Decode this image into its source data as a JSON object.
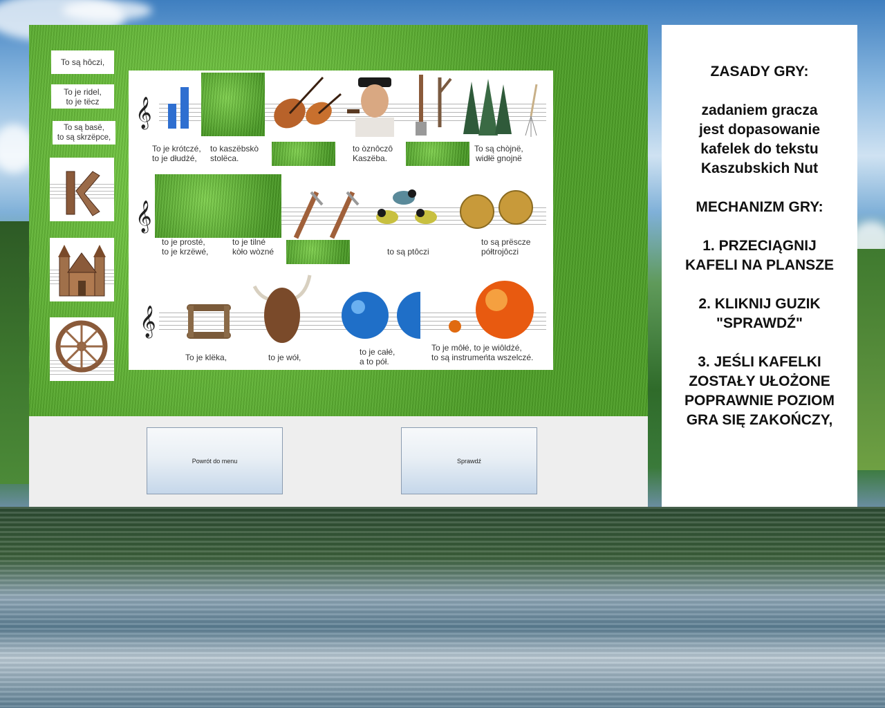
{
  "tiles": {
    "label1": "To są hôczi,",
    "label2": "To je ridel,\nto je tëcz",
    "label3": "To są basë,\nto są skrzëpce,",
    "icon_k": "letter-k-tile-icon",
    "icon_church": "church-tile-icon",
    "icon_wheel": "wheel-tile-icon"
  },
  "board": {
    "row1": {
      "t1": "To je krótczé,\nto je dłudżé,",
      "t2": "to kaszëbskò\nstolëca.",
      "t3": "to òznôczô\nKaszëba.",
      "t4": "To są chòjnë,\nwidłë gnojnë"
    },
    "row2": {
      "t1": "to je prosté,\nto je krzëwé,",
      "t2": "to je tilné\nkòło wòzné",
      "t3": "to są ptôczi",
      "t4": "to są prëscze\npółtrojôczi"
    },
    "row3": {
      "t1": "To je klëka,",
      "t2": "to je wół,",
      "t3": "to je całé,\na to pół.",
      "t4": "To je môłé, to je wiôldżé,\nto są instrumeńta wszelczé."
    }
  },
  "buttons": {
    "back": "Powrót do menu",
    "check": "Sprawdź"
  },
  "rules": {
    "title": "ZASADY GRY:",
    "goal1": "zadaniem gracza",
    "goal2": "jest dopasowanie",
    "goal3": "kafelek do tekstu",
    "goal4": "Kaszubskich Nut",
    "mech_title": "MECHANIZM GRY:",
    "s1a": "1. PRZECIĄGNIJ",
    "s1b": "KAFELI NA PLANSZE",
    "s2a": "2. KLIKNIJ GUZIK",
    "s2b": "\"SPRAWDŹ\"",
    "s3a": "3. JEŚLI KAFELKI",
    "s3b": "ZOSTAŁY UŁOŻONE",
    "s3c": "POPRAWNIE POZIOM",
    "s3d": "GRA SIĘ ZAKOŃCZY,"
  },
  "colors": {
    "grass": "#5aa832",
    "button_top": "#f7f9fb",
    "button_bottom": "#c5d7ea"
  }
}
